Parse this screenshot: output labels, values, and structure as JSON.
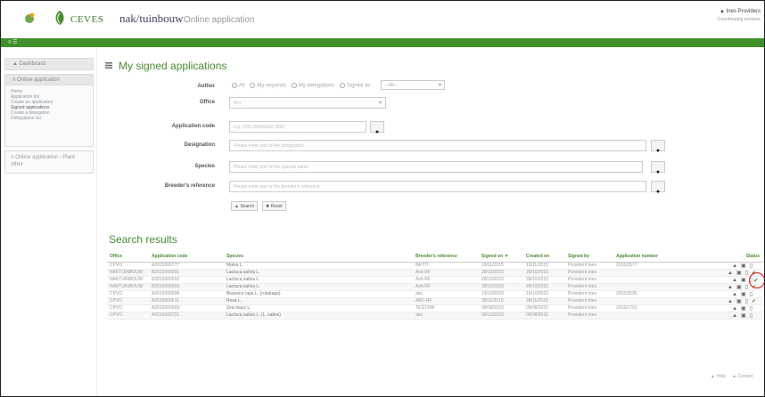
{
  "header": {
    "brand1": "CEVES",
    "brand2": "nak/tuinbouw",
    "subtitle": "Online application",
    "user_name": "▲ Ines Providers",
    "user_sub": "Coordinating sections"
  },
  "green_bar": {
    "label": "≡ ☰"
  },
  "sidebar": {
    "dashboard": "▲ Dashboard",
    "group_title": "≡ Online application",
    "items": [
      {
        "label": "Home"
      },
      {
        "label": "Application list"
      },
      {
        "label": "Create an application"
      },
      {
        "label": "Signed applications"
      },
      {
        "label": "Create a delegation"
      },
      {
        "label": "Delegations list"
      }
    ],
    "other": "≡ Online application - Plant other"
  },
  "page_title": "My signed applications",
  "form": {
    "author_label": "Author",
    "author_options": [
      "All",
      "My requests",
      "My delegations",
      "Signed as"
    ],
    "author_select": "—All—",
    "office_label": "Office",
    "office_value": "Any",
    "appcode_label": "Application code",
    "appcode_placeholder": "e.g. GPC-00000000-0000",
    "designation_label": "Designation",
    "designation_placeholder": "Please enter part of the designation",
    "species_label": "Species",
    "species_placeholder": "Please enter part of the species name",
    "breeder_label": "Breeder's reference",
    "breeder_placeholder": "Please enter part of the breeder's reference",
    "search_label": "▲ Search",
    "reset_label": "✖ Reset"
  },
  "results": {
    "title": "Search results",
    "columns": [
      "Office",
      "Application code",
      "Species",
      "Breeder's reference",
      "Signed on ▼",
      "Created on",
      "Signed by",
      "Application number",
      "Status"
    ],
    "rows": [
      {
        "office": "CPVO",
        "code": "A2015000777",
        "species": "Malva L.",
        "ref": "84/TTI",
        "signed": "19/11/2015",
        "created": "19/11/2015",
        "by": "Provident Ines",
        "number": "2015/2577",
        "ok": false
      },
      {
        "office": "NAKTUINBOUW",
        "code": "B2015000001",
        "species": "Lactuca sativa L.",
        "ref": "Anti-RF",
        "signed": "28/10/2015",
        "created": "28/10/2015",
        "by": "Provident Ines",
        "number": "",
        "ok": true
      },
      {
        "office": "NAKTUINBOUW",
        "code": "B2015000002",
        "species": "Lactuca sativa L.",
        "ref": "Anti-RF",
        "signed": "28/10/2015",
        "created": "28/10/2015",
        "by": "Provident Ines",
        "number": "",
        "ok": false
      },
      {
        "office": "NAKTUINBOUW",
        "code": "B2015000003",
        "species": "Lactuca sativa L.",
        "ref": "Anti-RF",
        "signed": "28/10/2015",
        "created": "28/10/2015",
        "by": "Provident Ines",
        "number": "",
        "ok": true
      },
      {
        "office": "CPVO",
        "code": "A2015000608",
        "species": "Brassica rapa L. (rutabaga)",
        "ref": "abc",
        "signed": "19/10/2015",
        "created": "19/10/2015",
        "by": "Provident Ines",
        "number": "2015/2595",
        "ok": false
      },
      {
        "office": "CPVO",
        "code": "A2015000611",
        "species": "Rosa L.",
        "ref": "ABC-RF",
        "signed": "28/11/2015",
        "created": "28/11/2015",
        "by": "Provident Ines",
        "number": "",
        "ok": true
      },
      {
        "office": "CPVO",
        "code": "A2015000669",
        "species": "Zea mays L.",
        "ref": "TEST-RR",
        "signed": "09/08/2015",
        "created": "09/08/2015",
        "by": "Provident Ines",
        "number": "2015/1761",
        "ok": false
      },
      {
        "office": "CPVO",
        "code": "A2015000721",
        "species": "Lactuca sativa L. (L. sativa)",
        "ref": "abc",
        "signed": "09/10/2015",
        "created": "09/08/2015",
        "by": "Provident Ines",
        "number": "",
        "ok": false
      }
    ]
  },
  "footer": {
    "help": "▲ Help",
    "contact": "▲ Contact"
  }
}
